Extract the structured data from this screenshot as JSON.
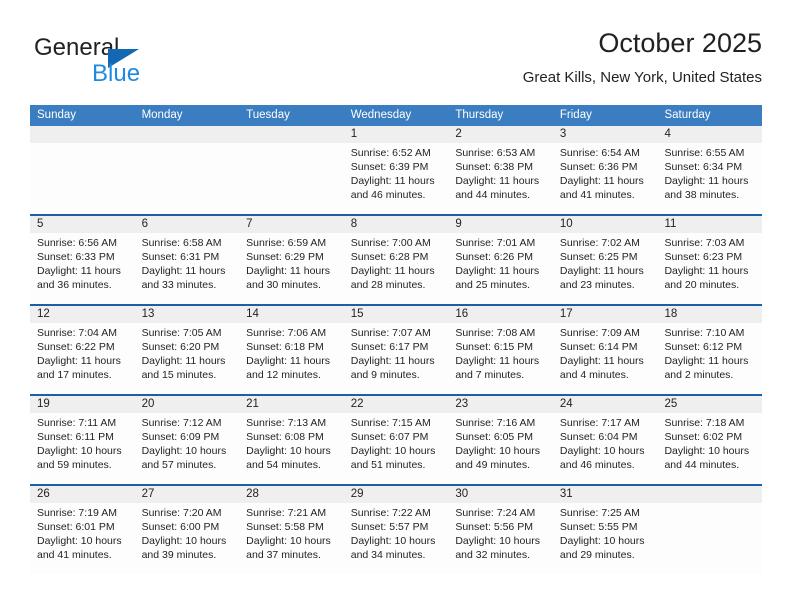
{
  "brand": {
    "name_top": "General",
    "name_bottom": "Blue",
    "triangle_color": "#1268b3",
    "blue_text_color": "#1f8ae0"
  },
  "header": {
    "title": "October 2025",
    "location": "Great Kills, New York, United States"
  },
  "theme": {
    "header_bg": "#3a7dc0",
    "header_text": "#ffffff",
    "week_rule": "#1b5fa8",
    "daynum_band": "#efefef",
    "body_text": "#231f20"
  },
  "calendar": {
    "weekday_headers": [
      "Sunday",
      "Monday",
      "Tuesday",
      "Wednesday",
      "Thursday",
      "Friday",
      "Saturday"
    ],
    "weeks": [
      [
        {
          "day": "",
          "lines": []
        },
        {
          "day": "",
          "lines": []
        },
        {
          "day": "",
          "lines": []
        },
        {
          "day": "1",
          "lines": [
            "Sunrise: 6:52 AM",
            "Sunset: 6:39 PM",
            "Daylight: 11 hours",
            "and 46 minutes."
          ]
        },
        {
          "day": "2",
          "lines": [
            "Sunrise: 6:53 AM",
            "Sunset: 6:38 PM",
            "Daylight: 11 hours",
            "and 44 minutes."
          ]
        },
        {
          "day": "3",
          "lines": [
            "Sunrise: 6:54 AM",
            "Sunset: 6:36 PM",
            "Daylight: 11 hours",
            "and 41 minutes."
          ]
        },
        {
          "day": "4",
          "lines": [
            "Sunrise: 6:55 AM",
            "Sunset: 6:34 PM",
            "Daylight: 11 hours",
            "and 38 minutes."
          ]
        }
      ],
      [
        {
          "day": "5",
          "lines": [
            "Sunrise: 6:56 AM",
            "Sunset: 6:33 PM",
            "Daylight: 11 hours",
            "and 36 minutes."
          ]
        },
        {
          "day": "6",
          "lines": [
            "Sunrise: 6:58 AM",
            "Sunset: 6:31 PM",
            "Daylight: 11 hours",
            "and 33 minutes."
          ]
        },
        {
          "day": "7",
          "lines": [
            "Sunrise: 6:59 AM",
            "Sunset: 6:29 PM",
            "Daylight: 11 hours",
            "and 30 minutes."
          ]
        },
        {
          "day": "8",
          "lines": [
            "Sunrise: 7:00 AM",
            "Sunset: 6:28 PM",
            "Daylight: 11 hours",
            "and 28 minutes."
          ]
        },
        {
          "day": "9",
          "lines": [
            "Sunrise: 7:01 AM",
            "Sunset: 6:26 PM",
            "Daylight: 11 hours",
            "and 25 minutes."
          ]
        },
        {
          "day": "10",
          "lines": [
            "Sunrise: 7:02 AM",
            "Sunset: 6:25 PM",
            "Daylight: 11 hours",
            "and 23 minutes."
          ]
        },
        {
          "day": "11",
          "lines": [
            "Sunrise: 7:03 AM",
            "Sunset: 6:23 PM",
            "Daylight: 11 hours",
            "and 20 minutes."
          ]
        }
      ],
      [
        {
          "day": "12",
          "lines": [
            "Sunrise: 7:04 AM",
            "Sunset: 6:22 PM",
            "Daylight: 11 hours",
            "and 17 minutes."
          ]
        },
        {
          "day": "13",
          "lines": [
            "Sunrise: 7:05 AM",
            "Sunset: 6:20 PM",
            "Daylight: 11 hours",
            "and 15 minutes."
          ]
        },
        {
          "day": "14",
          "lines": [
            "Sunrise: 7:06 AM",
            "Sunset: 6:18 PM",
            "Daylight: 11 hours",
            "and 12 minutes."
          ]
        },
        {
          "day": "15",
          "lines": [
            "Sunrise: 7:07 AM",
            "Sunset: 6:17 PM",
            "Daylight: 11 hours",
            "and 9 minutes."
          ]
        },
        {
          "day": "16",
          "lines": [
            "Sunrise: 7:08 AM",
            "Sunset: 6:15 PM",
            "Daylight: 11 hours",
            "and 7 minutes."
          ]
        },
        {
          "day": "17",
          "lines": [
            "Sunrise: 7:09 AM",
            "Sunset: 6:14 PM",
            "Daylight: 11 hours",
            "and 4 minutes."
          ]
        },
        {
          "day": "18",
          "lines": [
            "Sunrise: 7:10 AM",
            "Sunset: 6:12 PM",
            "Daylight: 11 hours",
            "and 2 minutes."
          ]
        }
      ],
      [
        {
          "day": "19",
          "lines": [
            "Sunrise: 7:11 AM",
            "Sunset: 6:11 PM",
            "Daylight: 10 hours",
            "and 59 minutes."
          ]
        },
        {
          "day": "20",
          "lines": [
            "Sunrise: 7:12 AM",
            "Sunset: 6:09 PM",
            "Daylight: 10 hours",
            "and 57 minutes."
          ]
        },
        {
          "day": "21",
          "lines": [
            "Sunrise: 7:13 AM",
            "Sunset: 6:08 PM",
            "Daylight: 10 hours",
            "and 54 minutes."
          ]
        },
        {
          "day": "22",
          "lines": [
            "Sunrise: 7:15 AM",
            "Sunset: 6:07 PM",
            "Daylight: 10 hours",
            "and 51 minutes."
          ]
        },
        {
          "day": "23",
          "lines": [
            "Sunrise: 7:16 AM",
            "Sunset: 6:05 PM",
            "Daylight: 10 hours",
            "and 49 minutes."
          ]
        },
        {
          "day": "24",
          "lines": [
            "Sunrise: 7:17 AM",
            "Sunset: 6:04 PM",
            "Daylight: 10 hours",
            "and 46 minutes."
          ]
        },
        {
          "day": "25",
          "lines": [
            "Sunrise: 7:18 AM",
            "Sunset: 6:02 PM",
            "Daylight: 10 hours",
            "and 44 minutes."
          ]
        }
      ],
      [
        {
          "day": "26",
          "lines": [
            "Sunrise: 7:19 AM",
            "Sunset: 6:01 PM",
            "Daylight: 10 hours",
            "and 41 minutes."
          ]
        },
        {
          "day": "27",
          "lines": [
            "Sunrise: 7:20 AM",
            "Sunset: 6:00 PM",
            "Daylight: 10 hours",
            "and 39 minutes."
          ]
        },
        {
          "day": "28",
          "lines": [
            "Sunrise: 7:21 AM",
            "Sunset: 5:58 PM",
            "Daylight: 10 hours",
            "and 37 minutes."
          ]
        },
        {
          "day": "29",
          "lines": [
            "Sunrise: 7:22 AM",
            "Sunset: 5:57 PM",
            "Daylight: 10 hours",
            "and 34 minutes."
          ]
        },
        {
          "day": "30",
          "lines": [
            "Sunrise: 7:24 AM",
            "Sunset: 5:56 PM",
            "Daylight: 10 hours",
            "and 32 minutes."
          ]
        },
        {
          "day": "31",
          "lines": [
            "Sunrise: 7:25 AM",
            "Sunset: 5:55 PM",
            "Daylight: 10 hours",
            "and 29 minutes."
          ]
        },
        {
          "day": "",
          "lines": []
        }
      ]
    ]
  }
}
